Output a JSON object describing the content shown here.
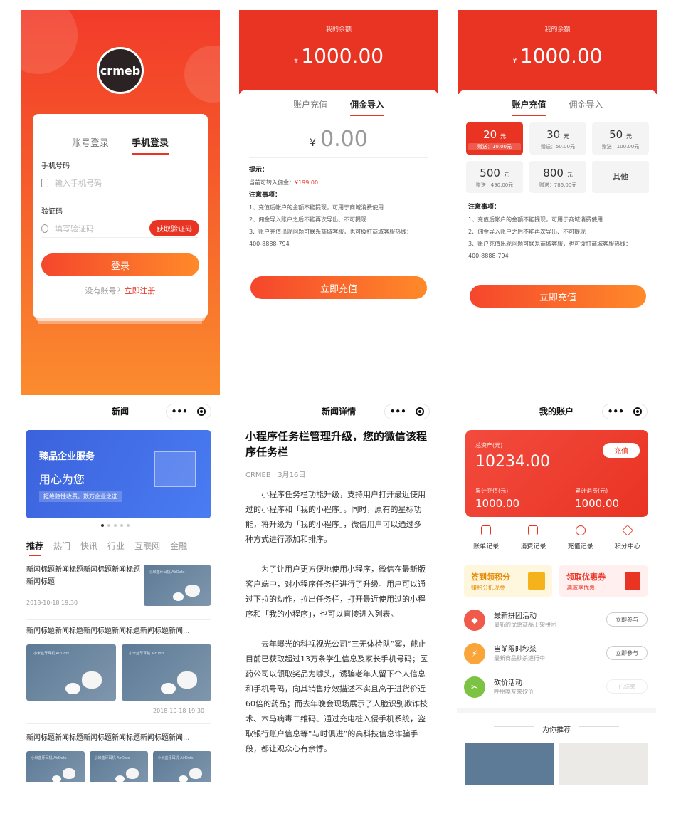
{
  "login": {
    "logo_text": "crmeb",
    "tab_account": "账号登录",
    "tab_phone": "手机登录",
    "phone_label": "手机号码",
    "phone_placeholder": "输入手机号码",
    "code_label": "验证码",
    "code_placeholder": "填写验证码",
    "get_code": "获取验证码",
    "login_button": "登录",
    "no_account": "没有账号？",
    "register": "立即注册"
  },
  "transfer": {
    "balance_label": "我的余额",
    "currency": "¥",
    "balance": "1000.00",
    "tab_recharge": "账户充值",
    "tab_import": "佣金导入",
    "input_currency": "¥",
    "input_value": "0.00",
    "tip_title": "提示：",
    "tip_text": "当前可转入佣金：",
    "tip_amount": "¥199.00",
    "notes_title": "注意事项：",
    "notes": [
      "1、充值后帐户的金额不能提现，可用于商城消费使用",
      "2、佣金导入账户之后不能再次导出、不可提现",
      "3、账户充值出现问题可联系商城客服，也可拨打商城客服热线：",
      "400-8888-794"
    ],
    "button": "立即充值"
  },
  "recharge": {
    "balance_label": "我的余额",
    "currency": "¥",
    "balance": "1000.00",
    "tab_recharge": "账户充值",
    "tab_import": "佣金导入",
    "unit": "元",
    "options": [
      {
        "value": "20",
        "gift": "赠送：10.00元"
      },
      {
        "value": "30",
        "gift": "赠送：50.00元"
      },
      {
        "value": "50",
        "gift": "赠送：100.00元"
      },
      {
        "value": "500",
        "gift": "赠送：490.00元"
      },
      {
        "value": "800",
        "gift": "赠送：786.00元"
      }
    ],
    "other": "其他",
    "notes_title": "注意事项：",
    "notes": [
      "1、充值后帐户的金额不能提现，可用于商城消费使用",
      "2、佣金导入账户之后不能再次导出、不可提现",
      "3、账户充值出现问题可联系商城客服，也可拨打商城客服热线：",
      "400-8888-794"
    ],
    "button": "立即充值"
  },
  "news": {
    "title": "新闻",
    "banner_title": "臻品企业服务",
    "banner_slogan": "用心为您",
    "banner_sub": "拒绝隐性收费，数万企业之选",
    "categories": [
      "推荐",
      "热门",
      "快讯",
      "行业",
      "互联网",
      "金融"
    ],
    "item1_title": "新闻标题新闻标题新闻标题新闻标题新闻标题",
    "item1_date": "2018-10-18 19:30",
    "item2_title": "新闻标题新闻标题新闻标题新闻标题新闻标题新闻...",
    "item2_date": "2018-10-18 19:30",
    "item3_title": "新闻标题新闻标题新闻标题新闻标题新闻标题新闻...",
    "thumb_caption": "小米蓝牙耳机 AirDots"
  },
  "detail": {
    "title": "新闻详情",
    "article_title": "小程序任务栏管理升级，您的微信该程序任务栏",
    "source": "CRMEB",
    "date": "3月16日",
    "paragraphs": [
      "小程序任务栏功能升级，支持用户打开最近使用过的小程序和「我的小程序」。同时，原有的星标功能，将升级为「我的小程序」，微信用户可以通过多种方式进行添加和排序。",
      "为了让用户更方便地使用小程序，微信在最新版客户端中，对小程序任务栏进行了升级。用户可以通过下拉的动作，拉出任务栏，打开最近使用过的小程序和「我的小程序」，也可以直接进入列表。",
      "去年曝光的科视视光公司“三无体检队”案，截止目前已获取超过13万条学生信息及家长手机号码；医药公司以领取奖品为噱头，诱骗老年人留下个人信息和手机号码，向其销售疗效描述不实且高于进货价近60倍的药品；而去年晚会现场展示了人脸识别欺诈技术、木马病毒二维码、通过充电桩入侵手机系统，盗取银行账户信息等“与时俱进”的高科技信息诈骗手段，都让观众心有余悸。"
    ]
  },
  "account": {
    "title": "我的账户",
    "total_label": "总资产(元)",
    "recharge_btn": "充值",
    "total": "10234.00",
    "cum_recharge_label": "累计充值(元)",
    "cum_recharge": "1000.00",
    "cum_spend_label": "累计消费(元)",
    "cum_spend": "1000.00",
    "menu": [
      "账单记录",
      "消费记录",
      "充值记录",
      "积分中心"
    ],
    "promo1_title": "签到领积分",
    "promo1_sub": "赚积分抵现金",
    "promo2_title": "领取优惠券",
    "promo2_sub": "满减享优惠",
    "activities": [
      {
        "title": "最新拼团活动",
        "sub": "最新的优惠商品上架拼团",
        "btn": "立即参与"
      },
      {
        "title": "当前限时秒杀",
        "sub": "最新商品秒杀进行中",
        "btn": "立即参与"
      },
      {
        "title": "砍价活动",
        "sub": "呼朋唤友来砍价",
        "btn": "已结束"
      }
    ],
    "recommend": "为你推荐"
  },
  "colors": {
    "primary": "#e93323",
    "orange": "#ff8a2a",
    "banner_blue": "#4a7cf2"
  }
}
